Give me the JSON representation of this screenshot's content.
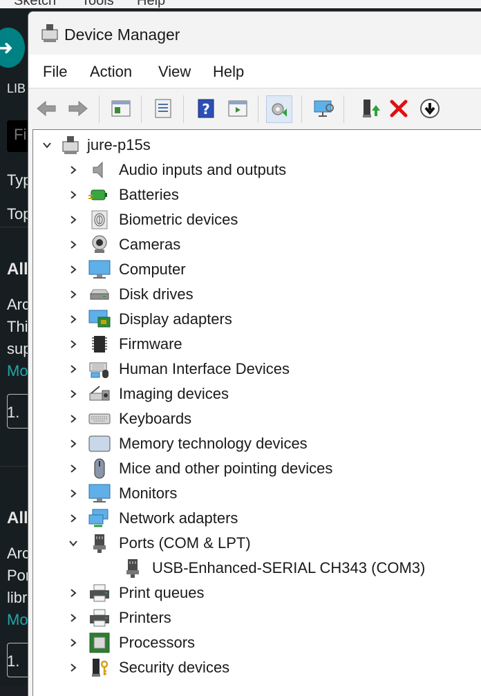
{
  "background": {
    "menu": [
      "Sketch",
      "Tools",
      "Help"
    ],
    "side_texts": [
      "LIB",
      "Fi",
      "Typ",
      "Top",
      "All",
      "Arc",
      "Thi",
      "sup",
      "Mo",
      "1.",
      "All",
      "Arc",
      "Por",
      "libr",
      "Mo",
      "1."
    ]
  },
  "window": {
    "title": "Device Manager",
    "menu": [
      "File",
      "Action",
      "View",
      "Help"
    ],
    "toolbar": [
      "back-icon",
      "forward-icon",
      "properties-pane-icon",
      "properties-icon",
      "help-icon",
      "show-hide-icon",
      "scan-hardware-icon",
      "monitor-icon",
      "update-driver-icon",
      "uninstall-icon",
      "disable-icon"
    ]
  },
  "tree": {
    "root": "jure-p15s",
    "categories": [
      {
        "label": "Audio inputs and outputs",
        "icon": "speaker-icon"
      },
      {
        "label": "Batteries",
        "icon": "battery-icon"
      },
      {
        "label": "Biometric devices",
        "icon": "fingerprint-icon"
      },
      {
        "label": "Cameras",
        "icon": "camera-icon"
      },
      {
        "label": "Computer",
        "icon": "computer-icon"
      },
      {
        "label": "Disk drives",
        "icon": "disk-drive-icon"
      },
      {
        "label": "Display adapters",
        "icon": "display-adapter-icon"
      },
      {
        "label": "Firmware",
        "icon": "firmware-icon"
      },
      {
        "label": "Human Interface Devices",
        "icon": "hid-icon"
      },
      {
        "label": "Imaging devices",
        "icon": "scanner-icon"
      },
      {
        "label": "Keyboards",
        "icon": "keyboard-icon"
      },
      {
        "label": "Memory technology devices",
        "icon": "memory-card-icon"
      },
      {
        "label": "Mice and other pointing devices",
        "icon": "mouse-icon"
      },
      {
        "label": "Monitors",
        "icon": "monitor-icon"
      },
      {
        "label": "Network adapters",
        "icon": "network-icon"
      },
      {
        "label": "Ports (COM & LPT)",
        "icon": "port-icon",
        "expanded": true
      },
      {
        "label": "USB-Enhanced-SERIAL CH343 (COM3)",
        "icon": "port-icon",
        "child": true
      },
      {
        "label": "Print queues",
        "icon": "printer-icon"
      },
      {
        "label": "Printers",
        "icon": "printer-icon"
      },
      {
        "label": "Processors",
        "icon": "processor-icon"
      },
      {
        "label": "Security devices",
        "icon": "security-key-icon"
      }
    ]
  }
}
